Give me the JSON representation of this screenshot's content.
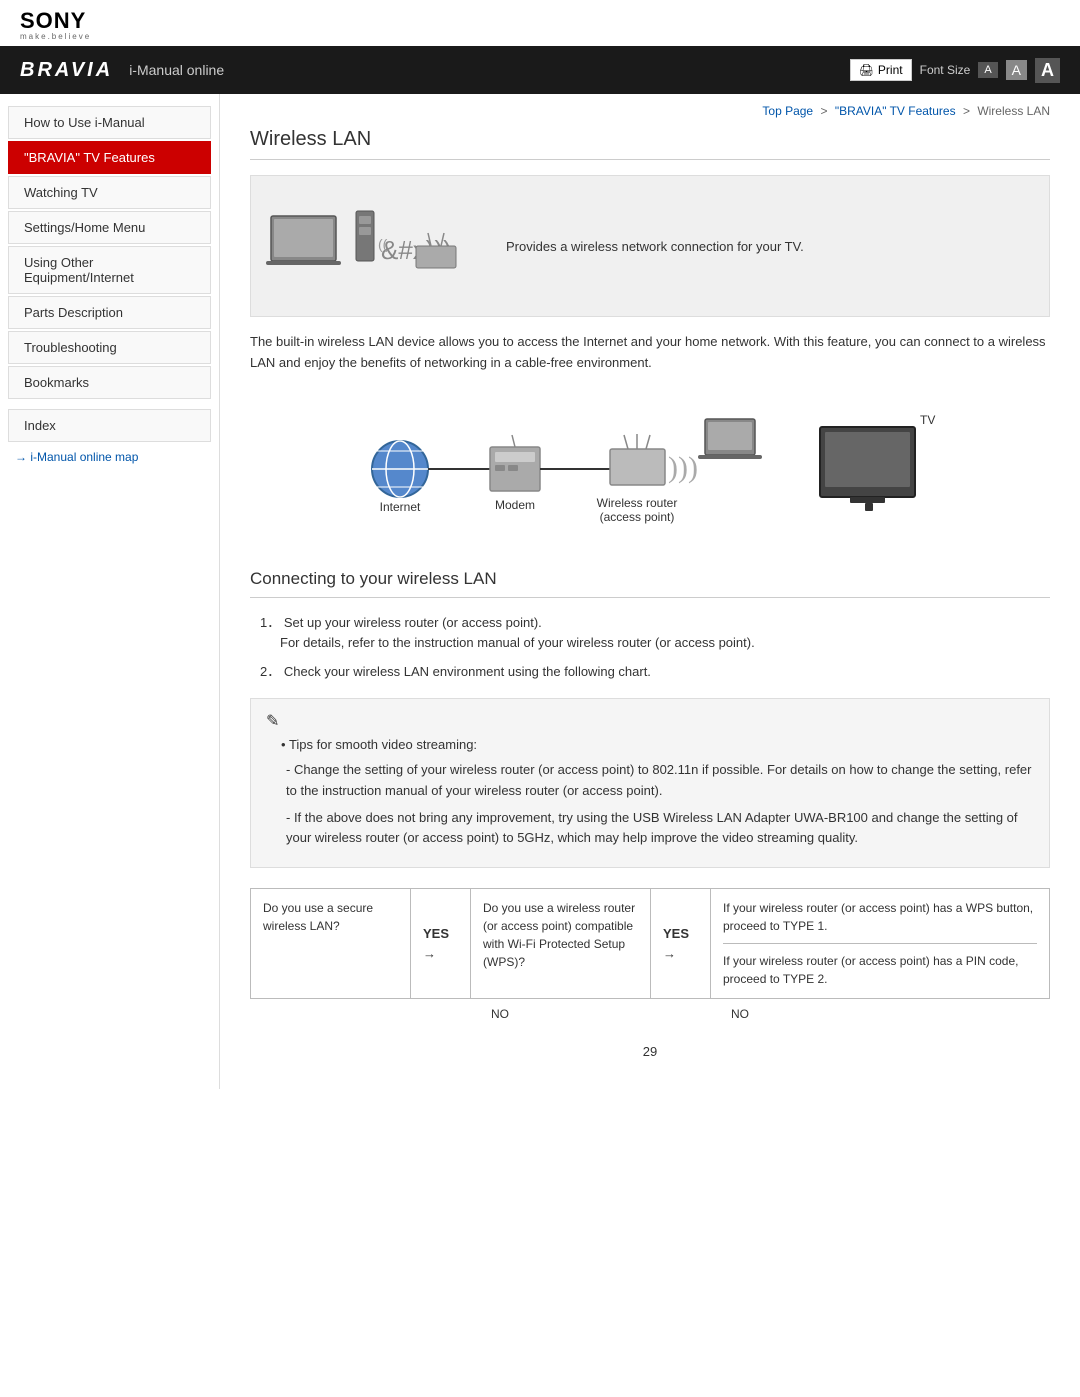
{
  "header": {
    "sony_logo": "SONY",
    "sony_tagline": "make.believe",
    "bravia_logo": "BRAVIA",
    "nav_title": "i-Manual online",
    "print_label": "Print",
    "font_size_label": "Font Size",
    "font_small": "A",
    "font_medium": "A",
    "font_large": "A"
  },
  "breadcrumb": {
    "top_page": "Top Page",
    "separator1": ">",
    "bravia_features": "\"BRAVIA\" TV Features",
    "separator2": ">",
    "current": "Wireless LAN"
  },
  "sidebar": {
    "items": [
      {
        "id": "how-to-use",
        "label": "How to Use i-Manual",
        "active": false
      },
      {
        "id": "bravia-tv-features",
        "label": "\"BRAVIA\" TV Features",
        "active": true
      },
      {
        "id": "watching-tv",
        "label": "Watching TV",
        "active": false
      },
      {
        "id": "settings-home-menu",
        "label": "Settings/Home Menu",
        "active": false
      },
      {
        "id": "using-other-equipment",
        "label": "Using Other Equipment/Internet",
        "active": false
      },
      {
        "id": "parts-description",
        "label": "Parts Description",
        "active": false
      },
      {
        "id": "troubleshooting",
        "label": "Troubleshooting",
        "active": false
      },
      {
        "id": "bookmarks",
        "label": "Bookmarks",
        "active": false
      }
    ],
    "index_label": "Index",
    "map_label": "i-Manual online map"
  },
  "content": {
    "page_title": "Wireless LAN",
    "diagram_desc": "Provides a wireless network connection for your TV.",
    "desc_text": "The built-in wireless LAN device allows you to access the Internet and your home network. With this feature, you can connect to a wireless LAN and enjoy the benefits of networking in a cable-free environment.",
    "diagram2": {
      "internet_label": "Internet",
      "modem_label": "Modem",
      "wireless_router_label": "Wireless router",
      "access_point_label": "(access point)",
      "tv_label": "TV"
    },
    "section_title": "Connecting to your wireless LAN",
    "step1": "Set up your wireless router (or access point).",
    "step1_sub": "For details, refer to the instruction manual of your wireless router (or access point).",
    "step2": "Check your wireless LAN environment using the following chart.",
    "note": {
      "icon": "✎",
      "bullet": "Tips for smooth video streaming:",
      "dash1": "- Change the setting of your wireless router (or access point) to 802.11n if possible. For details on how to change the setting, refer to the instruction manual of your wireless router (or access point).",
      "dash2": "- If the above does not bring any improvement, try using the USB Wireless LAN Adapter UWA-BR100 and change the setting of your wireless router (or access point) to 5GHz, which may help improve the video streaming quality."
    },
    "decision_chart": {
      "q1": "Do you use a secure wireless LAN?",
      "yes1": "YES →",
      "q2": "Do you use a wireless router (or access point) compatible with Wi-Fi Protected Setup (WPS)?",
      "yes2": "YES →",
      "ans_top": "If your wireless router (or access point) has a WPS button, proceed to TYPE 1.",
      "ans_bottom": "If your wireless router (or access point) has a PIN code, proceed to TYPE 2.",
      "no1": "NO",
      "no2": "NO"
    },
    "page_number": "29"
  }
}
